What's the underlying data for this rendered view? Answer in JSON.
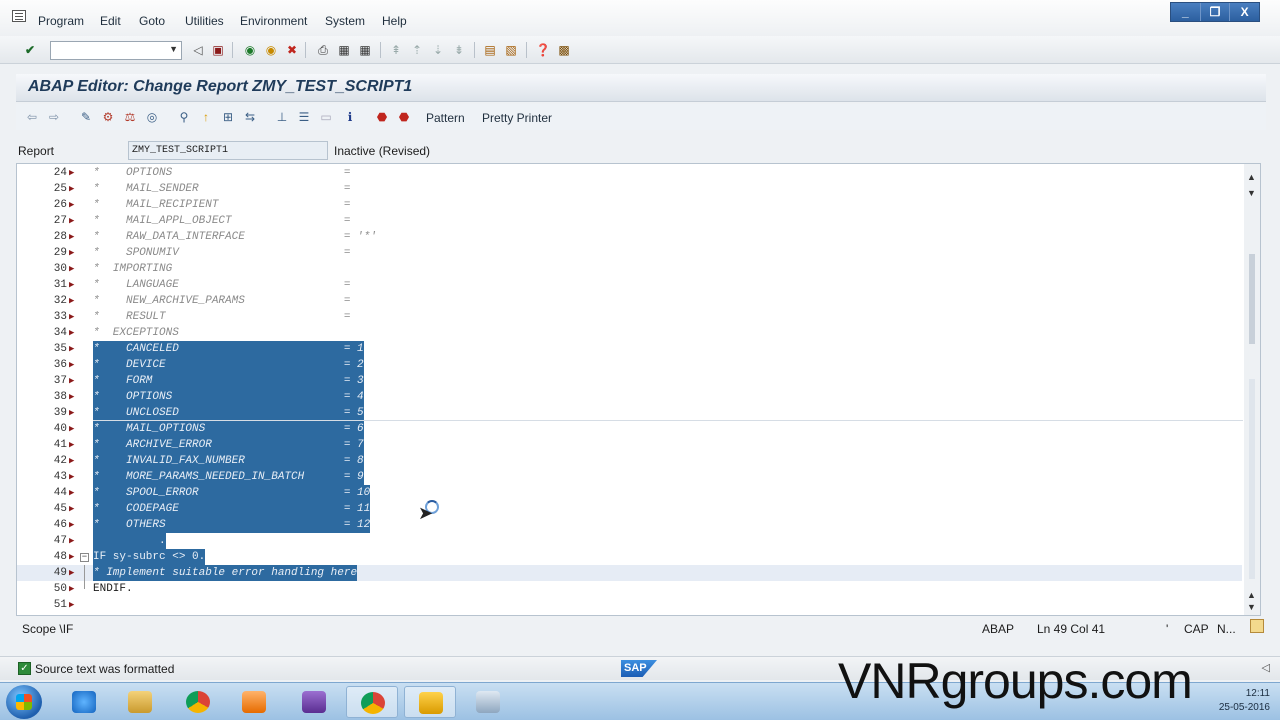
{
  "menu": [
    "Program",
    "Edit",
    "Goto",
    "Utilities",
    "Environment",
    "System",
    "Help"
  ],
  "window_controls": [
    "_",
    "❐",
    "X"
  ],
  "title": "ABAP Editor: Change Report ZMY_TEST_SCRIPT1",
  "app_toolbar": {
    "pattern": "Pattern",
    "pretty_printer": "Pretty Printer"
  },
  "report": {
    "label": "Report",
    "name": "ZMY_TEST_SCRIPT1",
    "status": "Inactive (Revised)"
  },
  "code_lines": [
    {
      "n": "24",
      "text": "*    OPTIONS                          =",
      "type": "comment"
    },
    {
      "n": "25",
      "text": "*    MAIL_SENDER                      =",
      "type": "comment"
    },
    {
      "n": "26",
      "text": "*    MAIL_RECIPIENT                   =",
      "type": "comment"
    },
    {
      "n": "27",
      "text": "*    MAIL_APPL_OBJECT                 =",
      "type": "comment"
    },
    {
      "n": "28",
      "text": "*    RAW_DATA_INTERFACE               = '*'",
      "type": "comment"
    },
    {
      "n": "29",
      "text": "*    SPONUMIV                         =",
      "type": "comment"
    },
    {
      "n": "30",
      "text": "*  IMPORTING",
      "type": "comment"
    },
    {
      "n": "31",
      "text": "*    LANGUAGE                         =",
      "type": "comment"
    },
    {
      "n": "32",
      "text": "*    NEW_ARCHIVE_PARAMS               =",
      "type": "comment"
    },
    {
      "n": "33",
      "text": "*    RESULT                           =",
      "type": "comment"
    },
    {
      "n": "34",
      "text": "*  EXCEPTIONS",
      "type": "comment"
    },
    {
      "n": "35",
      "text": "*    CANCELED                         = 1",
      "type": "sel"
    },
    {
      "n": "36",
      "text": "*    DEVICE                           = 2",
      "type": "sel"
    },
    {
      "n": "37",
      "text": "*    FORM                             = 3",
      "type": "sel"
    },
    {
      "n": "38",
      "text": "*    OPTIONS                          = 4",
      "type": "sel"
    },
    {
      "n": "39",
      "text": "*    UNCLOSED                         = 5",
      "type": "sel"
    },
    {
      "n": "40",
      "text": "*    MAIL_OPTIONS                     = 6",
      "type": "sel"
    },
    {
      "n": "41",
      "text": "*    ARCHIVE_ERROR                    = 7",
      "type": "sel"
    },
    {
      "n": "42",
      "text": "*    INVALID_FAX_NUMBER               = 8",
      "type": "sel"
    },
    {
      "n": "43",
      "text": "*    MORE_PARAMS_NEEDED_IN_BATCH      = 9",
      "type": "sel"
    },
    {
      "n": "44",
      "text": "*    SPOOL_ERROR                      = 10",
      "type": "sel"
    },
    {
      "n": "45",
      "text": "*    CODEPAGE                         = 11",
      "type": "sel"
    },
    {
      "n": "46",
      "text": "*    OTHERS                           = 12",
      "type": "sel"
    },
    {
      "n": "47",
      "text": "          .",
      "type": "sel"
    },
    {
      "n": "48",
      "text": "IF sy-subrc <> 0.",
      "type": "sel"
    },
    {
      "n": "49",
      "text": "* Implement suitable error handling here",
      "type": "sel"
    },
    {
      "n": "50",
      "text": "ENDIF.",
      "type": "code"
    },
    {
      "n": "51",
      "text": "",
      "type": "code"
    }
  ],
  "editor_status": {
    "scope": "Scope \\IF",
    "lang": "ABAP",
    "position": "Ln 49 Col 41",
    "quote": "'",
    "caps": "CAP",
    "num": "N..."
  },
  "sap_status": {
    "message": "Source text was formatted",
    "logo": "SAP"
  },
  "taskbar": {
    "time": "12:11",
    "date": "25-05-2016"
  },
  "watermark": "VNRgroups.com"
}
